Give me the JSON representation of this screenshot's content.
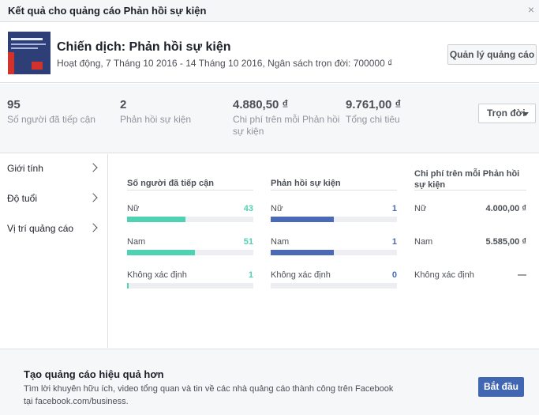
{
  "dialog": {
    "title": "Kết quả cho quảng cáo Phản hồi sự kiện",
    "close_glyph": "×"
  },
  "campaign": {
    "name": "Chiến dịch: Phản hồi sự kiện",
    "meta": "Hoạt động, 7 Tháng 10 2016 - 14 Tháng 10 2016, Ngân sách trọn đời: 700000 ₫",
    "manage_button": "Quản lý quảng cáo"
  },
  "stats": [
    {
      "value": "95",
      "label": "Số người đã tiếp cận"
    },
    {
      "value": "2",
      "label": "Phản hồi sự kiện"
    },
    {
      "value": "4.880,50 ₫",
      "label": "Chi phí trên mỗi Phản hồi sự kiện"
    },
    {
      "value": "9.761,00 ₫",
      "label": "Tổng chi tiêu"
    }
  ],
  "period_dropdown": "Trọn đời",
  "sidebar": {
    "items": [
      {
        "label": "Giới tính",
        "icon": "chevron-right-icon"
      },
      {
        "label": "Độ tuổi",
        "icon": "chevron-right-icon"
      },
      {
        "label": "Vị trí quảng cáo",
        "icon": "chevron-right-icon"
      }
    ]
  },
  "breakdown": {
    "columns": [
      {
        "header": "Số người đã tiếp cận",
        "color": "#4fd2b1",
        "rows": [
          {
            "label": "Nữ",
            "value": "43",
            "fraction": 0.46
          },
          {
            "label": "Nam",
            "value": "51",
            "fraction": 0.54
          },
          {
            "label": "Không xác định",
            "value": "1",
            "fraction": 0.01
          }
        ]
      },
      {
        "header": "Phản hồi sự kiện",
        "color": "#4a6ab5",
        "rows": [
          {
            "label": "Nữ",
            "value": "1",
            "fraction": 0.5
          },
          {
            "label": "Nam",
            "value": "1",
            "fraction": 0.5
          },
          {
            "label": "Không xác định",
            "value": "0",
            "fraction": 0
          }
        ]
      },
      {
        "header": "Chi phí trên mỗi Phản hồi sự kiện",
        "rows": [
          {
            "label": "Nữ",
            "value": "4.000,00 ₫"
          },
          {
            "label": "Nam",
            "value": "5.585,00 ₫"
          },
          {
            "label": "Không xác định",
            "value": "—"
          }
        ]
      }
    ]
  },
  "footer": {
    "title": "Tạo quảng cáo hiệu quả hơn",
    "description": "Tìm lời khuyên hữu ích, video tổng quan và tin về các nhà quảng cáo thành công trên Facebook tại facebook.com/business.",
    "start_button": "Bắt đầu"
  }
}
